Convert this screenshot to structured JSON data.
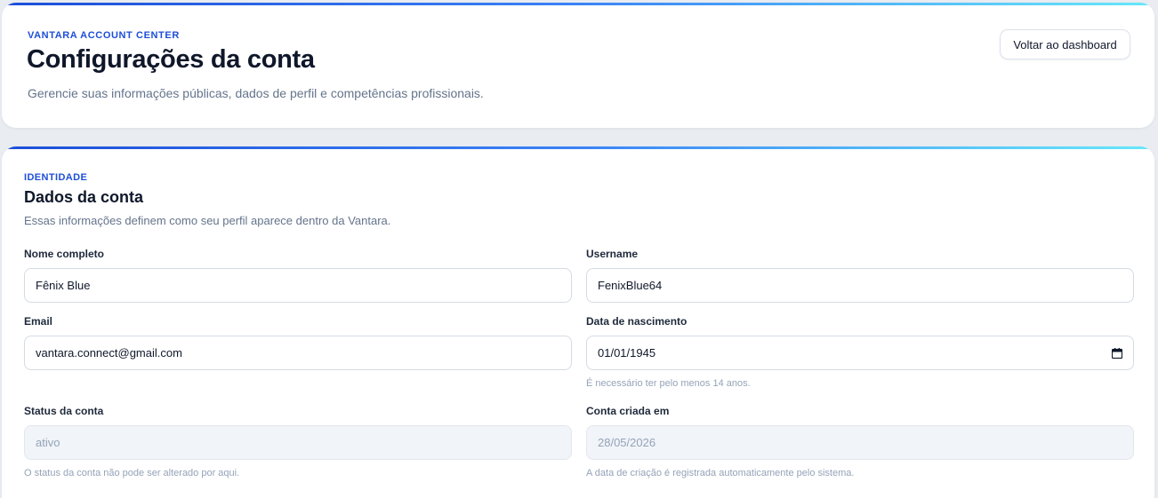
{
  "header": {
    "eyebrow": "VANTARA ACCOUNT CENTER",
    "title": "Configurações da conta",
    "subtitle": "Gerencie suas informações públicas, dados de perfil e competências profissionais.",
    "back_button": "Voltar ao dashboard"
  },
  "section": {
    "eyebrow": "IDENTIDADE",
    "title": "Dados da conta",
    "description": "Essas informações definem como seu perfil aparece dentro da Vantara."
  },
  "fields": {
    "full_name": {
      "label": "Nome completo",
      "value": "Fênix Blue"
    },
    "username": {
      "label": "Username",
      "value": "FenixBlue64"
    },
    "email": {
      "label": "Email",
      "value": "vantara.connect@gmail.com"
    },
    "birth_date": {
      "label": "Data de nascimento",
      "value": "01/01/1945",
      "hint": "É necessário ter pelo menos 14 anos.",
      "icon": "calendar-icon"
    },
    "status": {
      "label": "Status da conta",
      "value": "ativo",
      "hint": "O status da conta não pode ser alterado por aqui."
    },
    "created_at": {
      "label": "Conta criada em",
      "value": "28/05/2026",
      "hint": "A data de criação é registrada automaticamente pelo sistema."
    }
  },
  "colors": {
    "accent": "#1d4ed8",
    "accent_end": "#67e8f9",
    "background": "#e9edf2"
  }
}
